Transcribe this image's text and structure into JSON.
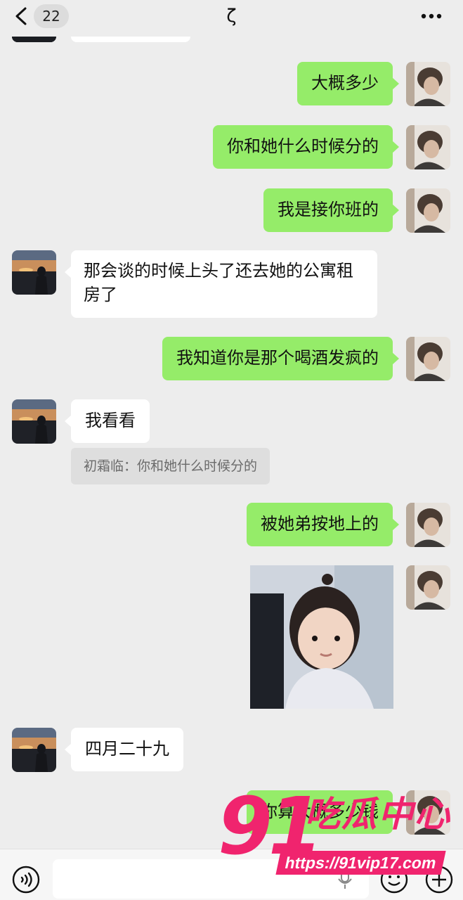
{
  "header": {
    "back_count": "22",
    "title": "ζ"
  },
  "messages": {
    "top_partial": "",
    "m1": "大概多少",
    "m2": "你和她什么时候分的",
    "m3": "我是接你班的",
    "m4": "那会谈的时候上头了还去她的公寓租房了",
    "m5": "我知道你是那个喝酒发疯的",
    "m6": "我看看",
    "m6_quote": "初霜临：你和她什么时候分的",
    "m7": "被她弟按地上的",
    "m8": "四月二十九",
    "m9": "你算大概多少钱"
  },
  "watermark": {
    "number": "91",
    "brand": "吃瓜中心",
    "url": "https://91vip17.com"
  },
  "colors": {
    "outgoing_bubble": "#95ec69",
    "incoming_bubble": "#ffffff",
    "background": "#ededed",
    "watermark": "#f0246e"
  },
  "icons": [
    "back-chevron-icon",
    "more-dots-icon",
    "voice-icon",
    "mic-icon",
    "emoji-icon",
    "plus-icon"
  ]
}
